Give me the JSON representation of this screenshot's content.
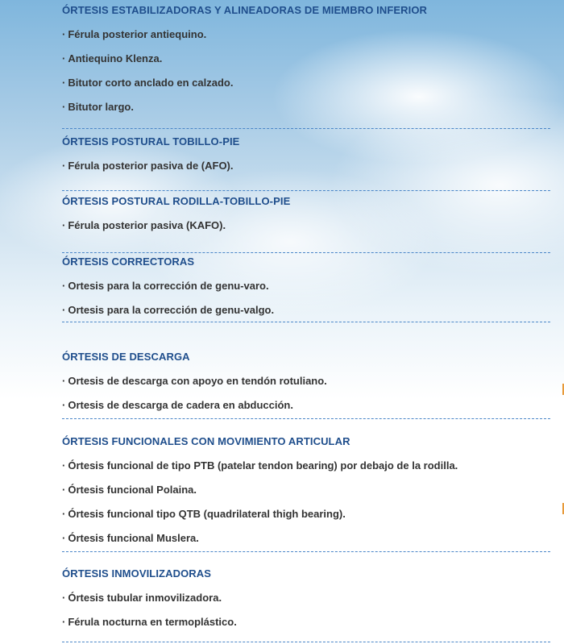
{
  "sections": [
    {
      "title": "ÓRTESIS ESTABILIZADORAS Y ALINEADORAS DE MIEMBRO INFERIOR",
      "items": [
        "Férula posterior antiequino.",
        "Antiequino Klenza.",
        "Bitutor corto anclado en calzado.",
        "Bitutor largo."
      ]
    },
    {
      "title": "ÓRTESIS POSTURAL TOBILLO-PIE",
      "items": [
        "Férula posterior pasiva de (AFO)."
      ]
    },
    {
      "title": "ÓRTESIS POSTURAL RODILLA-TOBILLO-PIE",
      "items": [
        "Férula posterior pasiva (KAFO)."
      ]
    },
    {
      "title": "ÓRTESIS CORRECTORAS",
      "items": [
        "Ortesis para la corrección de genu-varo.",
        "Ortesis para la corrección de genu-valgo."
      ]
    },
    {
      "title": "ÓRTESIS DE DESCARGA",
      "items": [
        "Ortesis de descarga con apoyo en tendón rotuliano.",
        "Ortesis de descarga de cadera en abducción."
      ]
    },
    {
      "title": "ÓRTESIS FUNCIONALES CON MOVIMIENTO ARTICULAR",
      "items": [
        "Órtesis funcional de tipo PTB (patelar tendon bearing) por debajo de la rodilla.",
        "Órtesis funcional Polaina.",
        "Órtesis funcional tipo QTB (quadrilateral thigh bearing).",
        "Órtesis funcional Muslera."
      ]
    },
    {
      "title": "ÓRTESIS INMOVILIZADORAS",
      "items": [
        "Órtesis tubular inmovilizadora.",
        "Férula nocturna en termoplástico."
      ]
    }
  ],
  "bullet": "·",
  "colors": {
    "title": "#1f4e8c",
    "text": "#333333",
    "divider": "#4a86c8",
    "accent": "#e79a3a"
  }
}
